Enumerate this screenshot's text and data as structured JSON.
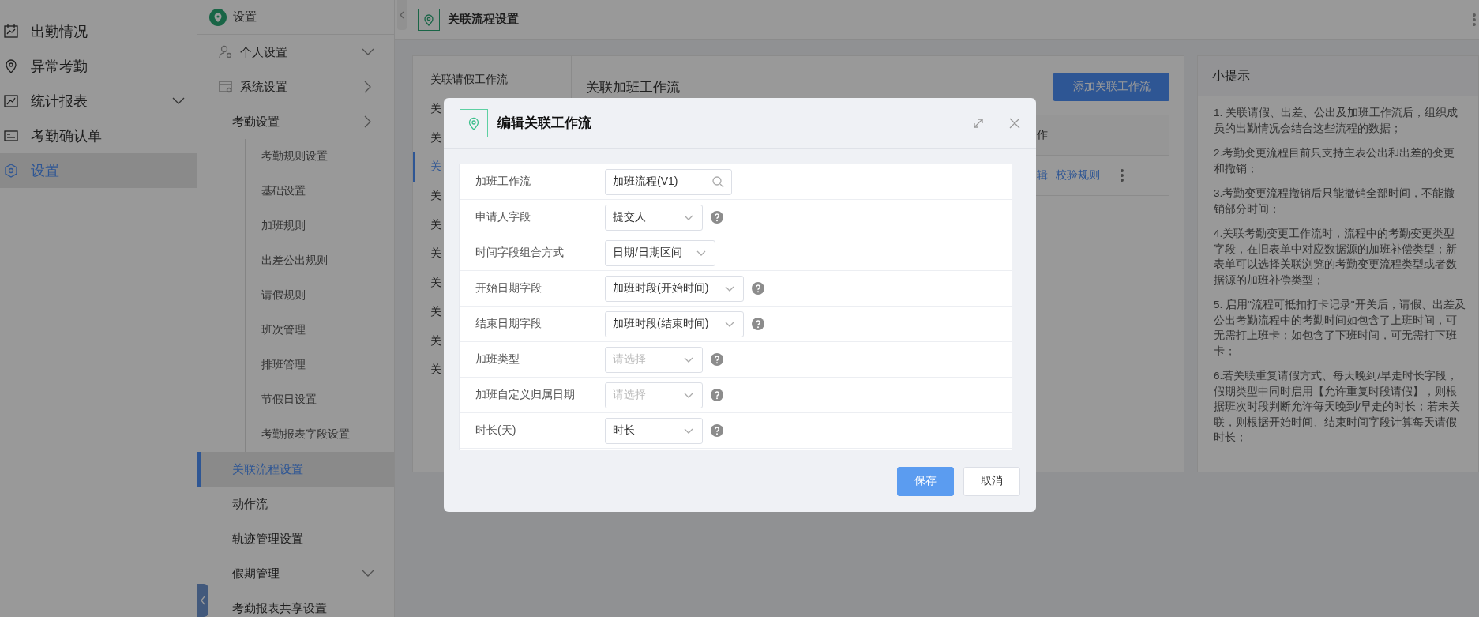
{
  "main_nav": {
    "items": [
      {
        "label": "出勤情况",
        "kind": "plain",
        "selected": false
      },
      {
        "label": "异常考勤",
        "kind": "plain",
        "selected": false
      },
      {
        "label": "统计报表",
        "kind": "dropdown",
        "selected": false
      },
      {
        "label": "考勤确认单",
        "kind": "plain",
        "selected": false
      },
      {
        "label": "设置",
        "kind": "plain",
        "selected": true
      }
    ]
  },
  "settings_nav": {
    "title": "设置",
    "items": [
      {
        "label": "个人设置",
        "kind": "dropdown",
        "selected": false
      },
      {
        "label": "系统设置",
        "kind": "flyout",
        "selected": false
      },
      {
        "label": "考勤设置",
        "kind": "flyout",
        "selected": false,
        "children": [
          {
            "label": "考勤规则设置",
            "selected": false
          },
          {
            "label": "基础设置",
            "selected": false
          },
          {
            "label": "加班规则",
            "selected": false
          },
          {
            "label": "出差公出规则",
            "selected": false
          },
          {
            "label": "请假规则",
            "selected": false
          },
          {
            "label": "班次管理",
            "selected": false
          },
          {
            "label": "排班管理",
            "selected": false
          },
          {
            "label": "节假日设置",
            "selected": false
          },
          {
            "label": "考勤报表字段设置",
            "selected": false
          }
        ]
      },
      {
        "label": "关联流程设置",
        "kind": "plain",
        "selected": true
      },
      {
        "label": "动作流",
        "kind": "plain",
        "selected": false
      },
      {
        "label": "轨迹管理设置",
        "kind": "plain",
        "selected": false
      },
      {
        "label": "假期管理",
        "kind": "dropdown",
        "selected": false
      },
      {
        "label": "考勤报表共享设置",
        "kind": "plain",
        "selected": false
      }
    ]
  },
  "top_bar": {
    "title": "关联流程设置"
  },
  "workflow_tabs": [
    {
      "label": "关联请假工作流",
      "selected": false
    },
    {
      "label": "关",
      "selected": false
    },
    {
      "label": "关",
      "selected": false
    },
    {
      "label": "关",
      "selected": true
    },
    {
      "label": "关",
      "selected": false
    },
    {
      "label": "关",
      "selected": false
    },
    {
      "label": "关",
      "selected": false
    },
    {
      "label": "关",
      "selected": false
    },
    {
      "label": "关",
      "selected": false
    },
    {
      "label": "关",
      "selected": false
    },
    {
      "label": "关",
      "selected": false
    }
  ],
  "panel": {
    "title": "关联加班工作流",
    "add_button": "添加关联工作流",
    "table": {
      "columns": [
        "作"
      ],
      "rows": [
        {
          "actions": [
            "辑",
            "校验规则"
          ]
        }
      ]
    }
  },
  "tips": {
    "title": "小提示",
    "items": [
      "1. 关联请假、出差、公出及加班工作流后，组织成员的出勤情况会结合这些流程的数据；",
      "2.考勤变更流程目前只支持主表公出和出差的变更和撤销；",
      "3.考勤变更流程撤销后只能撤销全部时间，不能撤销部分时间；",
      "4.关联考勤变更工作流时，流程中的考勤变更类型字段，在旧表单中对应数据源的加班补偿类型；新表单可以选择关联浏览的考勤变更流程类型或者数据源的加班补偿类型；",
      "5. 启用\"流程可抵扣打卡记录\"开关后，请假、出差及公出考勤流程中的考勤时间如包含了上班时间，可无需打上班卡；如包含了下班时间，可无需打下班卡；",
      "6.若关联重复请假方式、每天晚到/早走时长字段，假期类型中同时启用【允许重复时段请假】，则根据班次时段判断允许每天晚到/早走的时长；若未关联，则根据开始时间、结束时间字段计算每天请假时长；"
    ]
  },
  "modal": {
    "title": "编辑关联工作流",
    "fields": [
      {
        "label": "加班工作流",
        "kind": "search",
        "value": "加班流程(V1)",
        "help": false
      },
      {
        "label": "申请人字段",
        "kind": "select",
        "value": "提交人",
        "help": true
      },
      {
        "label": "时间字段组合方式",
        "kind": "select",
        "value": "日期/日期区间",
        "help": false
      },
      {
        "label": "开始日期字段",
        "kind": "select",
        "value": "加班时段(开始时间)",
        "help": true
      },
      {
        "label": "结束日期字段",
        "kind": "select",
        "value": "加班时段(结束时间)",
        "help": true
      },
      {
        "label": "加班类型",
        "kind": "select",
        "placeholder": "请选择",
        "help": true
      },
      {
        "label": "加班自定义归属日期",
        "kind": "select",
        "placeholder": "请选择",
        "help": true
      },
      {
        "label": "时长(天)",
        "kind": "select",
        "value": "时长",
        "help": true
      }
    ],
    "buttons": [
      {
        "label": "保存",
        "kind": "primary"
      },
      {
        "label": "取消",
        "kind": "default"
      }
    ]
  }
}
